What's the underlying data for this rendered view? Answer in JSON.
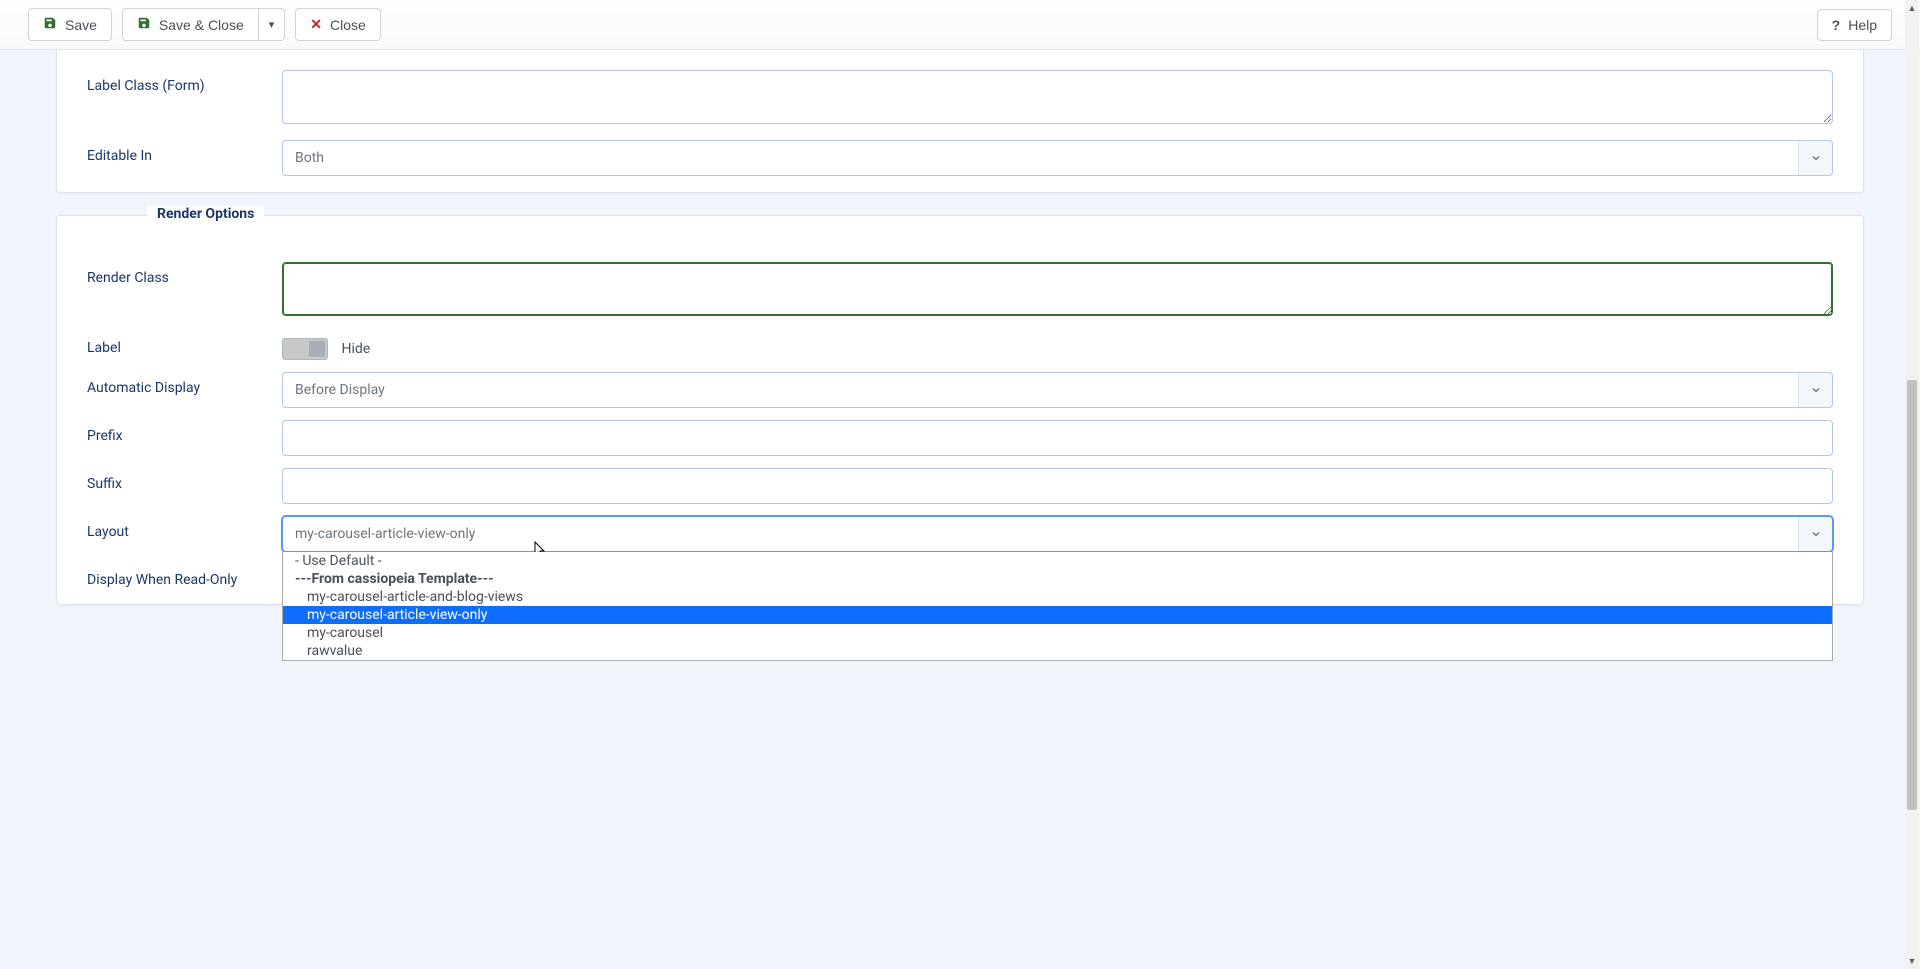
{
  "toolbar": {
    "save": "Save",
    "save_close": "Save & Close",
    "close": "Close",
    "help": "Help"
  },
  "top_fields": {
    "label_class_form": {
      "label": "Label Class (Form)",
      "value": ""
    },
    "editable_in": {
      "label": "Editable In",
      "value": "Both"
    }
  },
  "render_options": {
    "legend": "Render Options",
    "render_class": {
      "label": "Render Class",
      "value": ""
    },
    "label_toggle": {
      "label": "Label",
      "state_text": "Hide"
    },
    "automatic_display": {
      "label": "Automatic Display",
      "value": "Before Display"
    },
    "prefix": {
      "label": "Prefix",
      "value": ""
    },
    "suffix": {
      "label": "Suffix",
      "value": ""
    },
    "layout": {
      "label": "Layout",
      "selected": "my-carousel-article-view-only",
      "options": [
        {
          "text": "- Use Default -",
          "indent": false,
          "group": false,
          "highlighted": false
        },
        {
          "text": "---From cassiopeia Template---",
          "indent": false,
          "group": true,
          "highlighted": false
        },
        {
          "text": "my-carousel-article-and-blog-views",
          "indent": true,
          "group": false,
          "highlighted": false
        },
        {
          "text": "my-carousel-article-view-only",
          "indent": true,
          "group": false,
          "highlighted": true
        },
        {
          "text": "my-carousel",
          "indent": true,
          "group": false,
          "highlighted": false
        },
        {
          "text": "rawvalue",
          "indent": true,
          "group": false,
          "highlighted": false
        }
      ]
    },
    "display_readonly": {
      "label": "Display When Read-Only"
    }
  }
}
